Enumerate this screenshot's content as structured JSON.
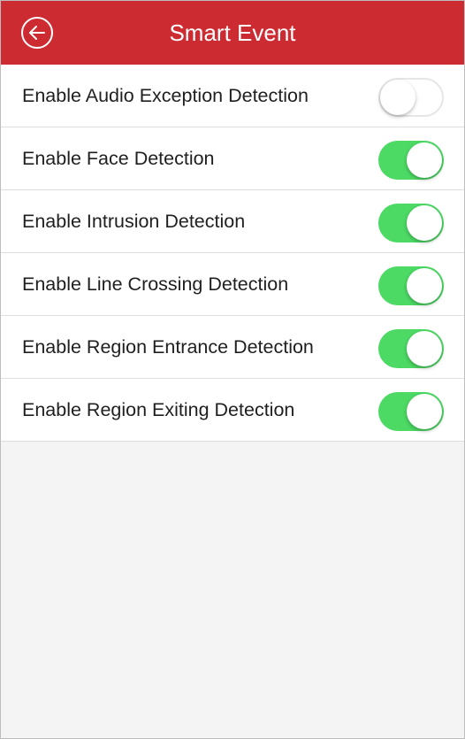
{
  "header": {
    "title": "Smart Event",
    "back_icon": "arrow-left-circle-icon",
    "color": "#cd2b32"
  },
  "settings": [
    {
      "label": "Enable Audio Exception Detection",
      "enabled": false
    },
    {
      "label": "Enable Face Detection",
      "enabled": true
    },
    {
      "label": "Enable Intrusion Detection",
      "enabled": true
    },
    {
      "label": "Enable Line Crossing Detection",
      "enabled": true
    },
    {
      "label": "Enable Region Entrance Detection",
      "enabled": true
    },
    {
      "label": "Enable Region Exiting Detection",
      "enabled": true
    }
  ],
  "colors": {
    "toggle_on": "#4cd964",
    "background": "#f4f4f4"
  }
}
